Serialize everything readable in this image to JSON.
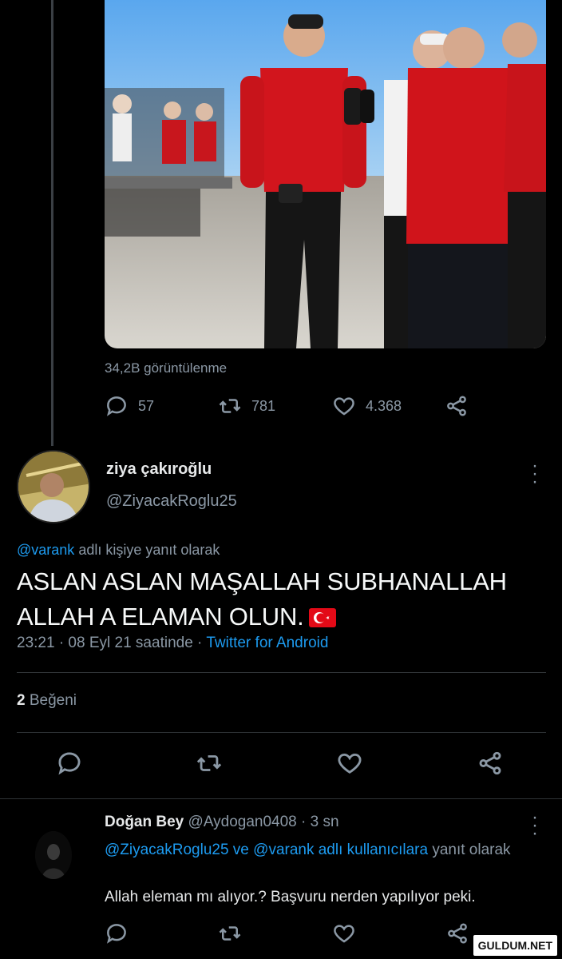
{
  "colors": {
    "background": "#000000",
    "text": "#e7e9ea",
    "muted": "#8b98a5",
    "link": "#1d9bf0",
    "divider": "#2f3336"
  },
  "parent_tweet": {
    "views": "34,2B görüntülenme",
    "actions": {
      "reply_icon": "comment-icon",
      "reply_count": "57",
      "retweet_icon": "retweet-icon",
      "retweet_count": "781",
      "like_icon": "heart-icon",
      "like_count": "4.368",
      "share_icon": "share-icon"
    }
  },
  "main_tweet": {
    "author_name": "ziya çakıroğlu",
    "author_handle": "@ZiyacakRoglu25",
    "reply_to_handle": "@varank",
    "reply_to_suffix": " adlı kişiye yanıt olarak",
    "text": "ASLAN ASLAN MAŞALLAH SUBHANALLAH ALLAH A ELAMAN OLUN.",
    "emoji": "turkey-flag-icon",
    "time": "23:21 · 08 Eyl 21 saatinde · ",
    "source": "Twitter for Android",
    "likes_count": "2",
    "likes_label": " Beğeni"
  },
  "reply_tweet": {
    "author_name": "Doğan Bey",
    "author_handle": " @Aydogan0408 · 3 sn",
    "context_links": "@ZiyacakRoglu25 ve @varank adlı kullanıcılara",
    "context_suffix": " yanıt olarak",
    "text": "Allah eleman mı alıyor.? Başvuru nerden yapılıyor peki."
  },
  "watermark": "GULDUM.NET"
}
